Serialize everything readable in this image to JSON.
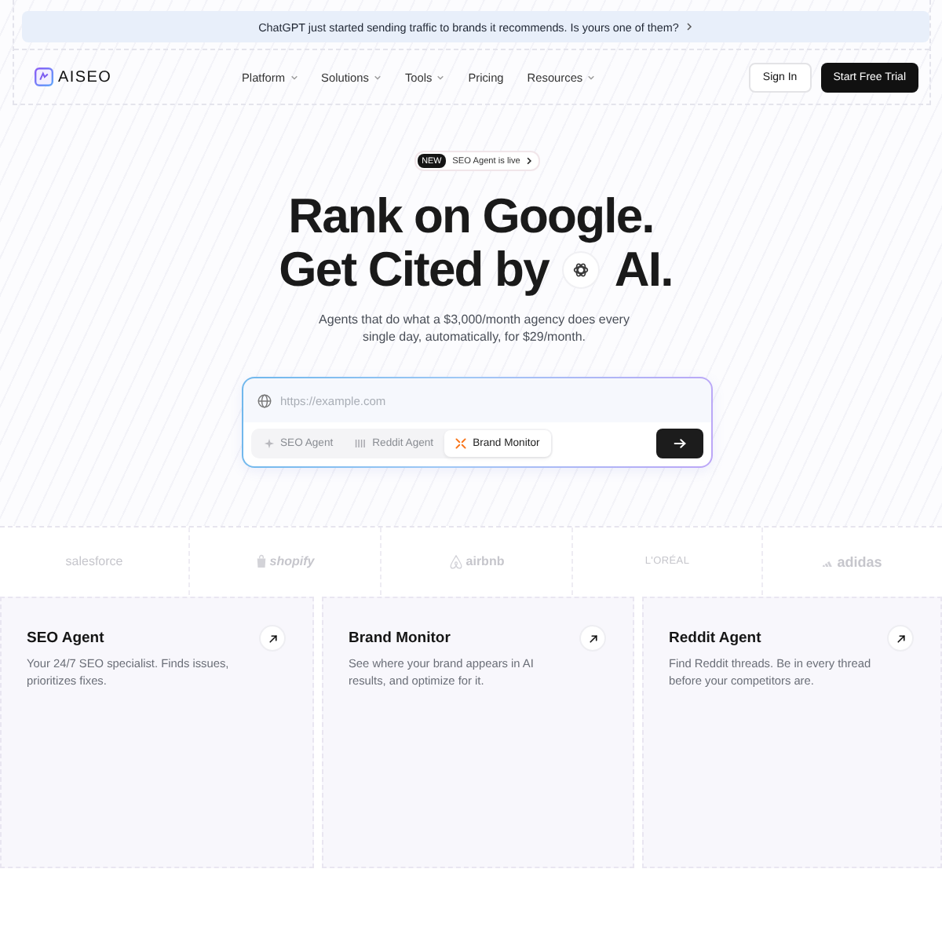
{
  "announcement": {
    "text": "ChatGPT just started sending traffic to brands it recommends. Is yours one of them?"
  },
  "nav": {
    "brand": "AISEO",
    "items": [
      {
        "label": "Platform",
        "menu": true
      },
      {
        "label": "Solutions",
        "menu": true
      },
      {
        "label": "Tools",
        "menu": true
      },
      {
        "label": "Pricing",
        "menu": false
      },
      {
        "label": "Resources",
        "menu": true
      }
    ],
    "sign_in": "Sign In",
    "cta": "Start Free Trial"
  },
  "hero": {
    "badge": {
      "tag": "NEW",
      "text": "SEO Agent is live"
    },
    "headline_line_1": "Rank on Google.",
    "headline_line_2_start": "Get Cited by",
    "headline_line_2_end": "AI.",
    "subtitle": "Agents that do what a $3,000/month agency does every single day, automatically, for $29/month."
  },
  "search": {
    "placeholder": "https://example.com",
    "agents": [
      {
        "label": "SEO Agent",
        "kind": "seo",
        "selected": false
      },
      {
        "label": "Reddit Agent",
        "kind": "reddit",
        "selected": false
      },
      {
        "label": "Brand Monitor",
        "kind": "brand",
        "selected": true
      }
    ]
  },
  "logos": [
    {
      "kind": "salesforce",
      "text": "salesforce"
    },
    {
      "kind": "shopify",
      "text": "shopify"
    },
    {
      "kind": "airbnb",
      "text": "airbnb"
    },
    {
      "kind": "loreal",
      "text": "L'ORÉAL"
    },
    {
      "kind": "adidas",
      "text": "adidas"
    }
  ],
  "cards": [
    {
      "title": "SEO Agent",
      "description": "Your 24/7 SEO specialist. Finds issues, prioritizes fixes."
    },
    {
      "title": "Brand Monitor",
      "description": "See where your brand appears in AI results, and optimize for it."
    },
    {
      "title": "Reddit Agent",
      "description": "Find Reddit threads. Be in every thread before your competitors are."
    }
  ]
}
